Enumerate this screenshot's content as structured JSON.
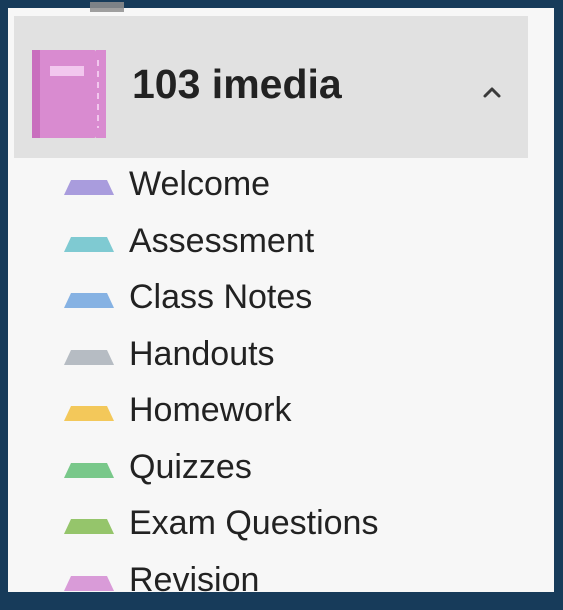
{
  "notebook": {
    "title": "103 imedia",
    "icon": "notebook-icon",
    "color": "#d98bd0",
    "expanded": true,
    "collapse_icon": "chevron-up-icon"
  },
  "sections": [
    {
      "label": "Welcome",
      "color": "#a99cdd"
    },
    {
      "label": "Assessment",
      "color": "#7fcad2"
    },
    {
      "label": "Class Notes",
      "color": "#86b2e3"
    },
    {
      "label": "Handouts",
      "color": "#b6bcc3"
    },
    {
      "label": "Homework",
      "color": "#f3c85a"
    },
    {
      "label": "Quizzes",
      "color": "#79c88a"
    },
    {
      "label": "Exam Questions",
      "color": "#95c56b"
    },
    {
      "label": "Revision",
      "color": "#d99bd8"
    }
  ]
}
